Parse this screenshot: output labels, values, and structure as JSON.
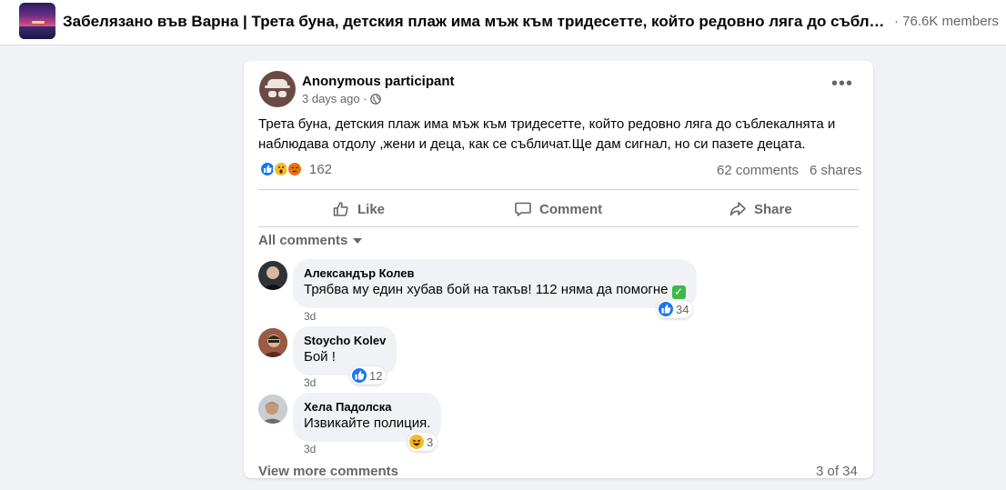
{
  "group": {
    "title": "Забелязано във Варна | Трета буна, детския плаж има мъж към тридесетте, който редовно ляга до съблекалнят...",
    "members": "· 76.6K members"
  },
  "post": {
    "author": "Anonymous participant",
    "time": "3 days ago ·",
    "text": "Трета буна, детския плаж има мъж към тридесетте, който редовно ляга до съблекалнята и наблюдава отдолу ,жени и деца, как се събличат.Ще дам сигнал, но си пазете децата.",
    "reactions_count": "162",
    "reaction_icons": [
      "like-icon",
      "wow-icon",
      "angry-icon"
    ],
    "comments_count": "62 comments",
    "shares_count": "6 shares"
  },
  "actions": {
    "like": "Like",
    "comment": "Comment",
    "share": "Share"
  },
  "comments_header": "All comments",
  "comments": [
    {
      "name": "Александър Колев",
      "text": "Трябва му един хубав бой на такъв! 112 няма да помогне",
      "time": "3d",
      "reactions": "34",
      "reaction_icon": "like-icon"
    },
    {
      "name": "Stoycho Kolev",
      "text": "Бой !",
      "time": "3d",
      "reactions": "12",
      "reaction_icon": "like-icon"
    },
    {
      "name": "Хела Падолска",
      "text": "Извикайте полиция.",
      "time": "3d",
      "reactions": "3",
      "reaction_icon": "haha-icon"
    }
  ],
  "footer": {
    "view_more": "View more comments",
    "pager": "3 of 34"
  },
  "colors": {
    "like_blue": "#1877f2",
    "secondary_text": "#65676b",
    "page_bg": "#f0f2f5"
  }
}
